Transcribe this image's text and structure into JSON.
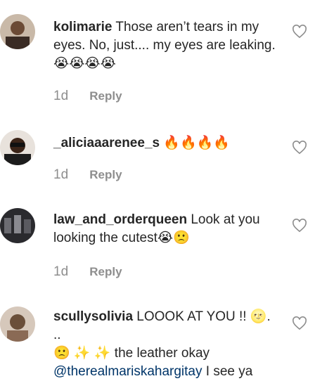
{
  "comments": [
    {
      "username": "kolimarie",
      "text": "Those aren’t tears in my eyes. No, just.... my eyes are leaking. 😭😭😭😭",
      "time": "1d",
      "reply": "Reply"
    },
    {
      "username": "_aliciaaarenee_s",
      "text": "🔥🔥🔥🔥",
      "time": "1d",
      "reply": "Reply"
    },
    {
      "username": "law_and_orderqueen",
      "text": "Look at you looking the cutest😭🙁",
      "time": "1d",
      "reply": "Reply"
    },
    {
      "username": "scullysolivia",
      "text_line1": "LOOOK AT YOU !! 🌝. ..",
      "text_line2": "🙁 ✨ ✨ the leather okay",
      "mention": "@therealmariskahargitay",
      "text_after_mention": " I see ya"
    }
  ],
  "icons": {
    "like": "heart-outline-icon"
  },
  "colors": {
    "username": "#262626",
    "meta": "#8e8e8e",
    "mention": "#003569"
  }
}
